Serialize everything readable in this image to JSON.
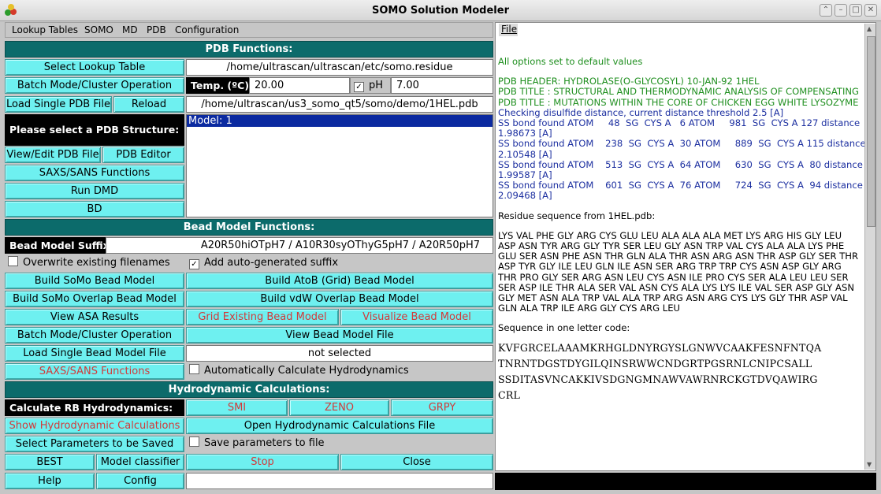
{
  "window": {
    "title": "SOMO Solution Modeler"
  },
  "menu": [
    {
      "label": "Lookup Tables"
    },
    {
      "label": "SOMO"
    },
    {
      "label": "MD"
    },
    {
      "label": "PDB"
    },
    {
      "label": "Configuration"
    }
  ],
  "pdb": {
    "section_title": "PDB Functions:",
    "select_lookup": "Select Lookup Table",
    "lookup_path": "/home/ultrascan/ultrascan/etc/somo.residue",
    "batch_mode": "Batch Mode/Cluster Operation",
    "temp_label": "Temp. (ºC):",
    "temp_value": "20.00",
    "ph_label": "pH",
    "ph_value": "7.00",
    "load_single": "Load Single PDB File",
    "reload": "Reload",
    "pdb_path": "/home/ultrascan/us3_somo_qt5/somo/demo/1HEL.pdb",
    "select_structure": "Please select a PDB Structure:",
    "model_item": "Model: 1",
    "view_edit": "View/Edit PDB File",
    "pdb_editor": "PDB Editor",
    "saxs_sans": "SAXS/SANS Functions",
    "run_dmd": "Run DMD",
    "bd": "BD"
  },
  "bead": {
    "section_title": "Bead Model Functions:",
    "suffix_label": "Bead Model Suffix:",
    "suffix_value": "A20R50hiOTpH7 / A10R30syOThyG5pH7 / A20R50pH7",
    "overwrite": "Overwrite existing filenames",
    "auto_suffix": "Add auto-generated suffix",
    "build_somo": "Build SoMo Bead Model",
    "build_atob": "Build AtoB (Grid) Bead Model",
    "build_somo_overlap": "Build SoMo Overlap Bead Model",
    "build_vdw": "Build vdW Overlap Bead Model",
    "view_asa": "View ASA Results",
    "grid_existing": "Grid Existing Bead Model",
    "visualize": "Visualize Bead Model",
    "batch_mode": "Batch Mode/Cluster Operation",
    "view_bead_file": "View Bead Model File",
    "load_single": "Load Single Bead Model File",
    "not_selected": "not selected",
    "saxs_sans": "SAXS/SANS Functions",
    "auto_hydro": "Automatically Calculate Hydrodynamics"
  },
  "hydro": {
    "section_title": "Hydrodynamic Calculations:",
    "calc_rb": "Calculate RB Hydrodynamics:",
    "smi": "SMI",
    "zeno": "ZENO",
    "grpy": "GRPY",
    "show_calc": "Show Hydrodynamic Calculations",
    "open_file": "Open Hydrodynamic Calculations File",
    "select_params": "Select Parameters to be Saved",
    "save_params": "Save parameters to file",
    "best": "BEST",
    "model_classifier": "Model classifier",
    "stop": "Stop",
    "close": "Close",
    "help": "Help",
    "config": "Config"
  },
  "log": {
    "file_menu": "File",
    "defaults": "All options set to default values",
    "header": "PDB HEADER: HYDROLASE(O-GLYCOSYL) 10-JAN-92 1HEL",
    "title1": "PDB TITLE : STRUCTURAL AND THERMODYNAMIC ANALYSIS OF COMPENSATING",
    "title2": "PDB TITLE :  MUTATIONS WITHIN THE CORE OF CHICKEN EGG WHITE LYSOZYME",
    "disulfide": "Checking disulfide distance, current distance threshold 2.5 [A]",
    "ss1a": "SS bond found ATOM     48  SG  CYS A   6 ATOM     981  SG  CYS A 127 distance",
    "ss1b": "1.98673 [A]",
    "ss2a": "SS bond found ATOM    238  SG  CYS A  30 ATOM     889  SG  CYS A 115 distance",
    "ss2b": "2.10548 [A]",
    "ss3a": "SS bond found ATOM    513  SG  CYS A  64 ATOM     630  SG  CYS A  80 distance",
    "ss3b": "1.99587 [A]",
    "ss4a": "SS bond found ATOM    601  SG  CYS A  76 ATOM     724  SG  CYS A  94 distance",
    "ss4b": "2.09468 [A]",
    "residue_label": "Residue sequence from 1HEL.pdb:",
    "residue_seq": "LYS VAL PHE GLY ARG CYS GLU LEU ALA ALA ALA MET LYS ARG HIS GLY LEU ASP ASN TYR ARG GLY TYR SER LEU GLY ASN TRP VAL CYS ALA ALA LYS PHE GLU SER ASN PHE ASN THR GLN ALA THR ASN ARG ASN THR ASP GLY SER THR ASP TYR GLY ILE LEU GLN ILE ASN SER ARG TRP TRP CYS ASN ASP GLY ARG THR PRO GLY SER ARG ASN LEU CYS ASN ILE PRO CYS SER ALA LEU LEU SER SER ASP ILE THR ALA SER VAL ASN CYS ALA LYS LYS ILE VAL SER ASP GLY ASN GLY MET ASN ALA TRP VAL ALA TRP ARG ASN ARG CYS LYS GLY THR ASP VAL GLN ALA TRP ILE ARG GLY CYS ARG LEU",
    "one_letter_label": "Sequence in one letter code:",
    "seq1": "KVFGRCELAAAMKRHGLDNYRGYSLGNWVCAAKFESNFNTQA",
    "seq2": "TNRNTDGSTDYGILQINSRWWCNDGRTPGSRNLCNIPCSALL",
    "seq3": "SSDITASVNCAKKIVSDGNGMNAWVAWRNRCKGTDVQAWIRG",
    "seq4": "CRL"
  }
}
